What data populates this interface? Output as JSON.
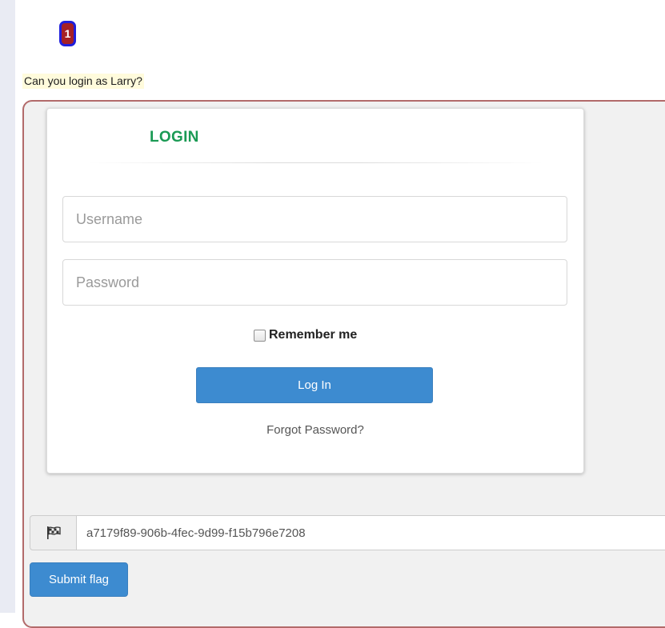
{
  "badge": {
    "number": "1"
  },
  "question": "Can you login as Larry?",
  "login": {
    "title": "LOGIN",
    "username_placeholder": "Username",
    "password_placeholder": "Password",
    "remember_label": "Remember me",
    "remember_checked": false,
    "login_button": "Log In",
    "forgot_link": "Forgot Password?"
  },
  "flag": {
    "icon": "flag-checkered-icon",
    "value": "a7179f89-906b-4fec-9d99-f15b796e7208",
    "submit_label": "Submit flag"
  },
  "colors": {
    "title_green": "#1a9a54",
    "button_blue": "#3d8bd0",
    "badge_red": "#a52026",
    "badge_border": "#1f1fdc",
    "question_highlight": "#fffbdc"
  }
}
